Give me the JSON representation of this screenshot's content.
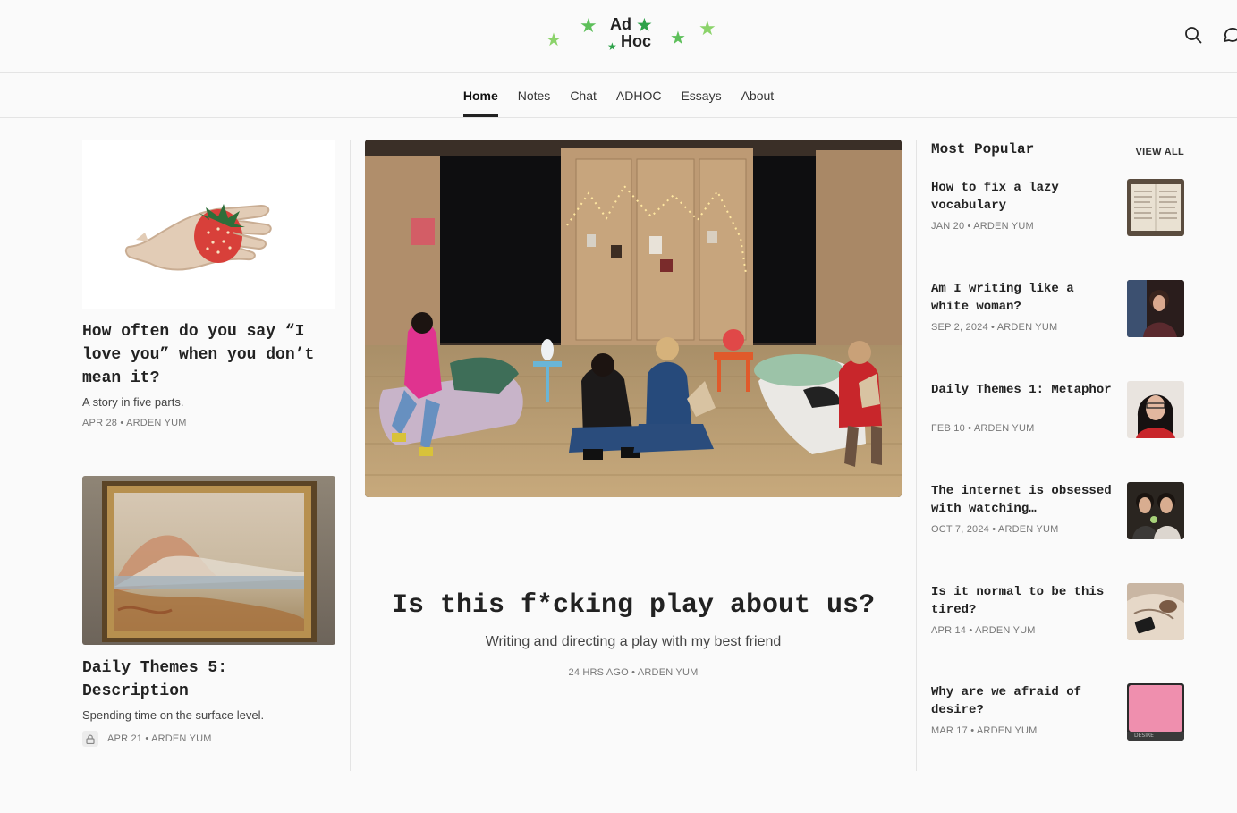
{
  "logo": {
    "line1": "Ad",
    "line2": "Hoc",
    "star_color_light": "#8bd36a",
    "star_color_dark": "#2ea24a"
  },
  "header_icons": [
    "search-icon",
    "chat-bubble-icon"
  ],
  "nav": {
    "tabs": [
      {
        "label": "Home",
        "active": true
      },
      {
        "label": "Notes"
      },
      {
        "label": "Chat"
      },
      {
        "label": "ADHOC"
      },
      {
        "label": "Essays"
      },
      {
        "label": "About"
      }
    ]
  },
  "left_posts": [
    {
      "title": "How often do you say “I love you” when you don’t mean it?",
      "subtitle": "A story in five parts.",
      "meta": "APR 28 • ARDEN YUM",
      "locked": false
    },
    {
      "title": "Daily Themes 5: Description",
      "subtitle": "Spending time on the surface level.",
      "meta": "APR 21 • ARDEN YUM",
      "locked": true
    }
  ],
  "featured": {
    "title": "Is this f*cking play about us?",
    "subtitle": "Writing and directing a play with my best friend",
    "meta": "24 HRS AGO • ARDEN YUM"
  },
  "popular": {
    "heading": "Most Popular",
    "view_all": "VIEW ALL",
    "items": [
      {
        "title": "How to fix a lazy vocabulary",
        "meta": "JAN 20 • ARDEN YUM"
      },
      {
        "title": "Am I writing like a white woman?",
        "meta": "SEP 2, 2024 • ARDEN YUM"
      },
      {
        "title": "Daily Themes 1: Metaphor",
        "meta": "FEB 10 • ARDEN YUM"
      },
      {
        "title": "The internet is obsessed with watching…",
        "meta": "OCT 7, 2024 • ARDEN YUM"
      },
      {
        "title": "Is it normal to be this tired?",
        "meta": "APR 14 • ARDEN YUM"
      },
      {
        "title": "Why are we afraid of desire?",
        "meta": "MAR 17 • ARDEN YUM"
      }
    ]
  },
  "thumb_texts": {
    "desire": "DESIRE"
  }
}
